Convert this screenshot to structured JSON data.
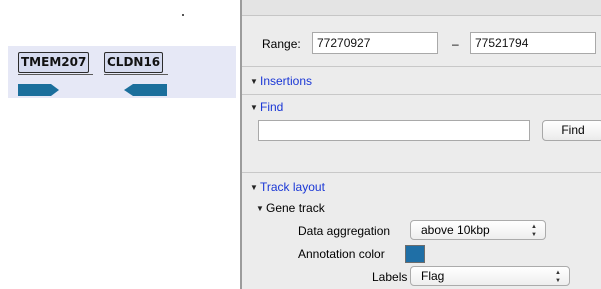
{
  "genome_view": {
    "genes": [
      {
        "label": "TMEM207",
        "strand": "+"
      },
      {
        "label": "CLDN16",
        "strand": "-"
      }
    ],
    "colors": {
      "track_background": "#e6e8f6",
      "arrow_fill": "#1b6f9c",
      "label_background": "#d6dbef"
    }
  },
  "panel": {
    "range": {
      "label": "Range:",
      "start": "77270927",
      "separator": "–",
      "end": "77521794"
    },
    "sections": {
      "insertions": "Insertions",
      "find": "Find",
      "track_layout": "Track layout"
    },
    "find": {
      "value": "",
      "button": "Find"
    },
    "gene_track": {
      "title": "Gene track",
      "data_aggregation": {
        "label": "Data aggregation",
        "value": "above 10kbp"
      },
      "annotation_color": {
        "label": "Annotation color",
        "color": "#1f6fa6"
      },
      "labels": {
        "label": "Labels",
        "value": "Flag"
      }
    },
    "colors": {
      "section_link": "#1a37d6",
      "panel_background": "#ececec"
    }
  }
}
